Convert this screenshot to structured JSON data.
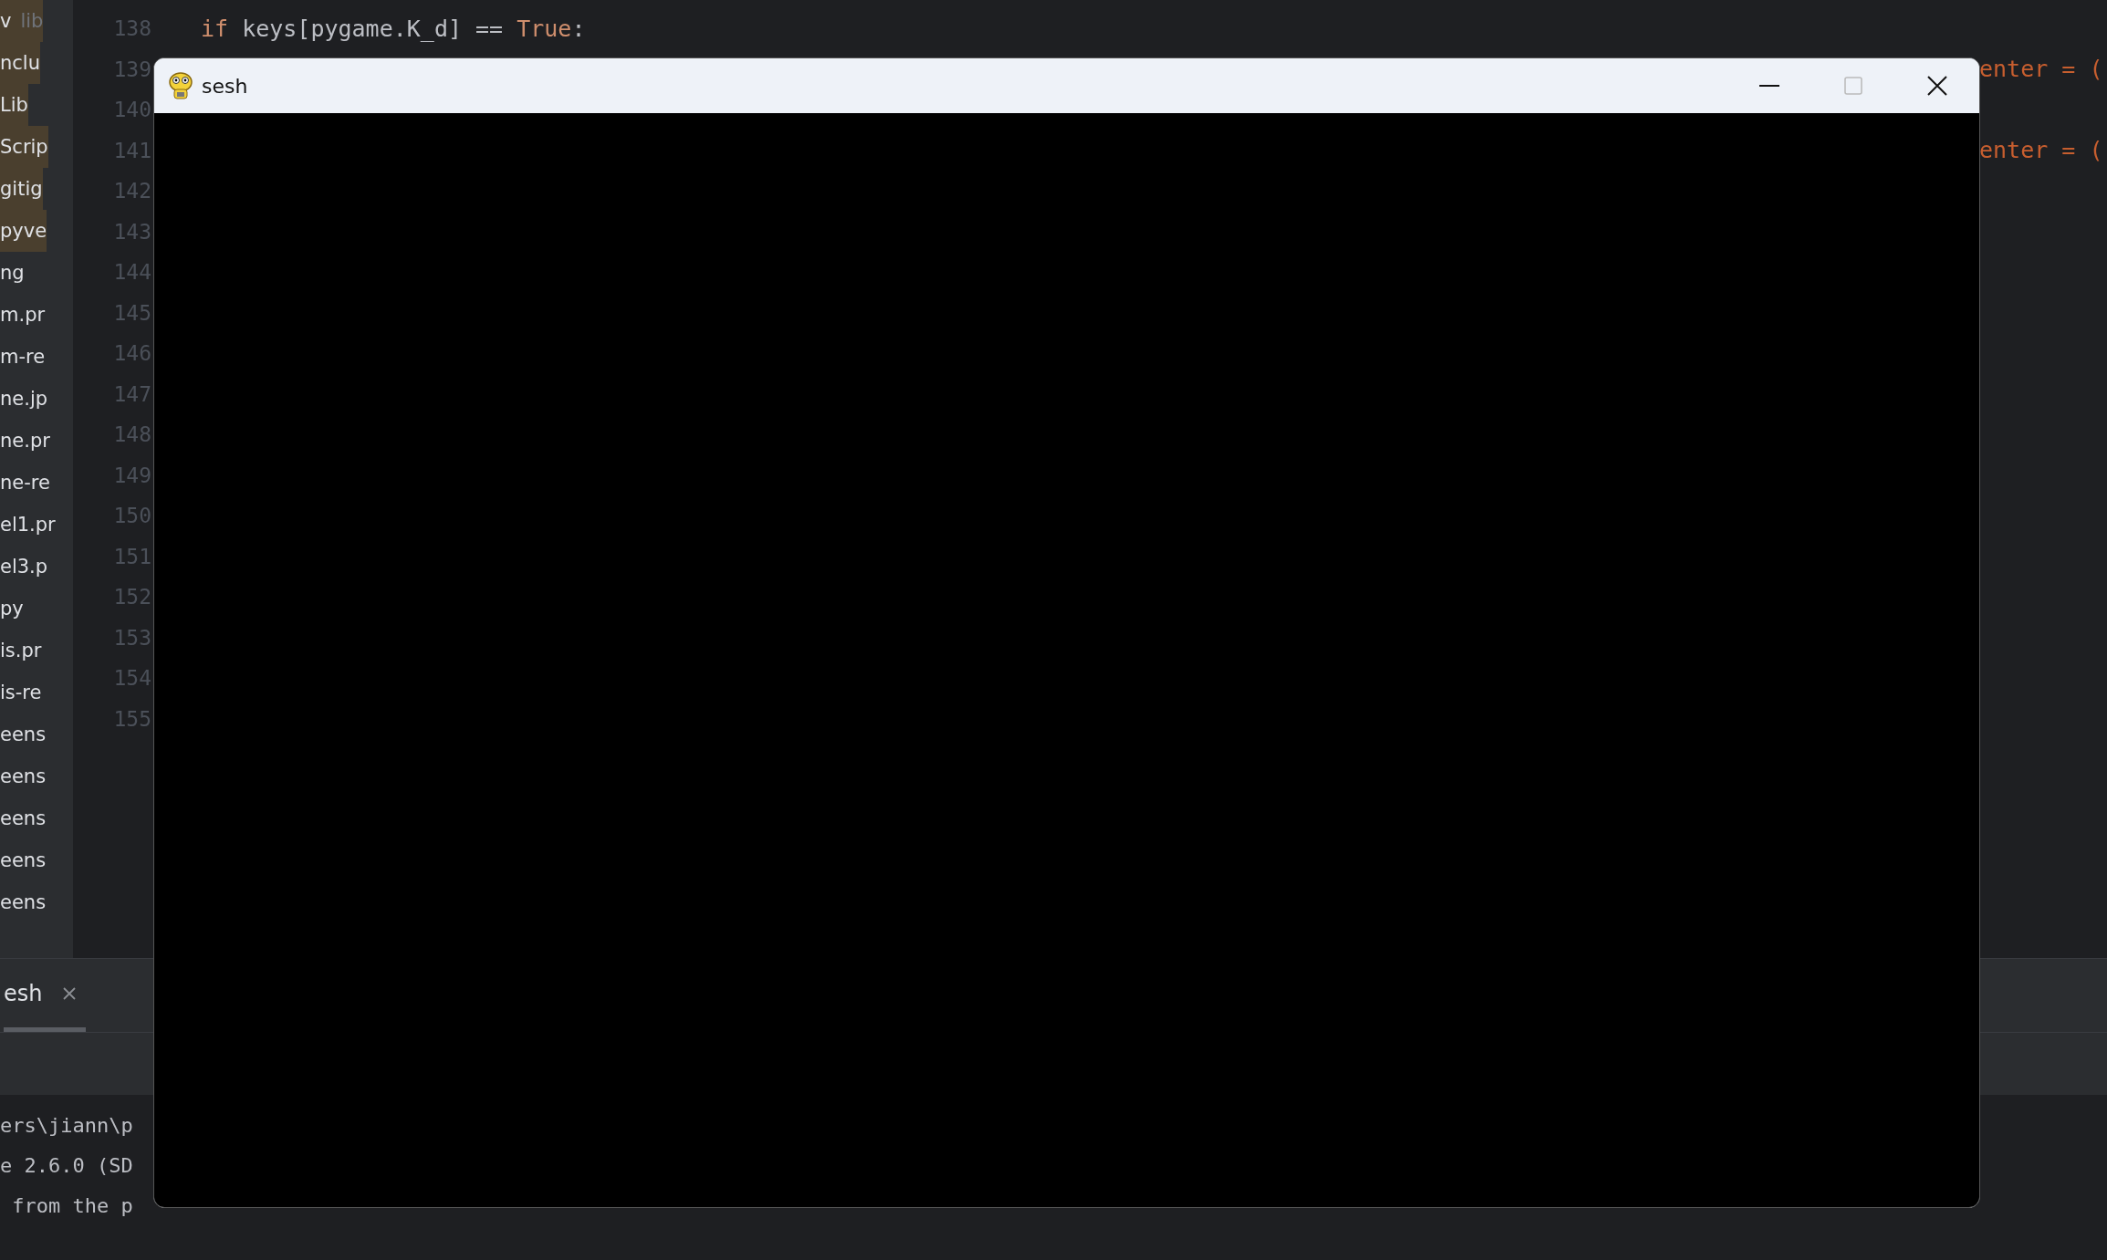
{
  "project_tree": {
    "items": [
      {
        "label": "v",
        "hint": "lib",
        "highlighted": true
      },
      {
        "label": "nclu",
        "highlighted": true
      },
      {
        "label": "Lib",
        "highlighted": true
      },
      {
        "label": "Scrip",
        "highlighted": true
      },
      {
        "label": "gitig",
        "highlighted": true
      },
      {
        "label": "pyve",
        "highlighted": true
      },
      {
        "label": "ng",
        "highlighted": false
      },
      {
        "label": "m.pr",
        "highlighted": false
      },
      {
        "label": "m-re",
        "highlighted": false
      },
      {
        "label": "ne.jp",
        "highlighted": false
      },
      {
        "label": "ne.pr",
        "highlighted": false
      },
      {
        "label": "ne-re",
        "highlighted": false
      },
      {
        "label": "el1.pr",
        "highlighted": false
      },
      {
        "label": "el3.p",
        "highlighted": false
      },
      {
        "label": "py",
        "highlighted": false
      },
      {
        "label": "is.pr",
        "highlighted": false
      },
      {
        "label": "is-re",
        "highlighted": false
      },
      {
        "label": "eens",
        "highlighted": false
      },
      {
        "label": "eens",
        "highlighted": false
      },
      {
        "label": "eens",
        "highlighted": false
      },
      {
        "label": "eens",
        "highlighted": false
      },
      {
        "label": "eens",
        "highlighted": false
      }
    ]
  },
  "editor": {
    "lines": [
      {
        "number": "138",
        "tokens": [
          {
            "kind": "keyword",
            "text": "if"
          },
          {
            "kind": "plain",
            "text": " keys[pygame.K_d] == "
          },
          {
            "kind": "keyword",
            "text": "True"
          },
          {
            "kind": "plain",
            "text": ":"
          }
        ]
      },
      {
        "number": "139",
        "tail": "enter = ("
      },
      {
        "number": "140"
      },
      {
        "number": "141",
        "tail": "enter = ("
      },
      {
        "number": "142"
      },
      {
        "number": "143"
      },
      {
        "number": "144"
      },
      {
        "number": "145"
      },
      {
        "number": "146"
      },
      {
        "number": "147"
      },
      {
        "number": "148"
      },
      {
        "number": "149"
      },
      {
        "number": "150"
      },
      {
        "number": "151"
      },
      {
        "number": "152"
      },
      {
        "number": "153"
      },
      {
        "number": "154"
      },
      {
        "number": "155"
      }
    ]
  },
  "run_panel": {
    "tab": {
      "label": "esh",
      "selected": true
    },
    "console_lines": [
      {
        "kind": "text",
        "text": "ers\\jiann\\p"
      },
      {
        "kind": "text",
        "text": "e 2.6.0 (SD"
      },
      {
        "kind": "text",
        "text": " from the p"
      }
    ]
  },
  "pygame_window": {
    "title": "sesh"
  }
}
